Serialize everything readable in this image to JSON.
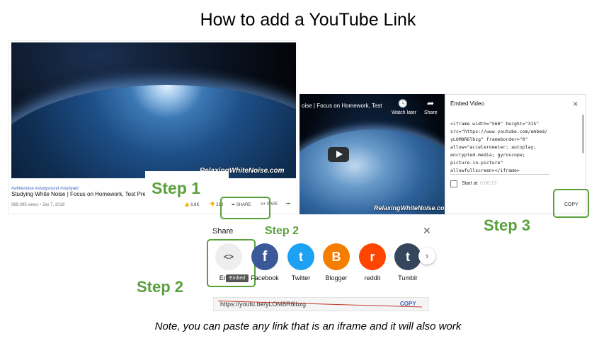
{
  "title": "How to add a YouTube Link",
  "step1": {
    "label": "Step 1"
  },
  "step2": {
    "label": "Step 2"
  },
  "step3": {
    "label": "Step 3"
  },
  "video1": {
    "watermark": "RelaxingWhiteNoise.com",
    "hashtags": "#whitenoise #studysound #studyaid",
    "title": "Studying White Noise | Focus on Homework, Test Prep,",
    "meta": "989,095 views • Jan 7, 2019",
    "likes": "6.8K",
    "dislikes": "213",
    "share": "SHARE",
    "save": "SAVE",
    "more": "•••"
  },
  "video2": {
    "caption": "oise | Focus on Homework, Test",
    "watch_later": "Watch later",
    "share": "Share",
    "watermark": "RelaxingWhiteNoise.com"
  },
  "embed": {
    "header": "Embed Video",
    "close": "✕",
    "code": [
      "<iframe width=\"560\" height=\"315\"",
      "src=\"https://www.youtube.com/embed/",
      "yLOM8R6lbzg\" frameborder=\"0\"",
      "allow=\"accelerometer; autoplay;",
      "encrypted-media; gyroscope;",
      "picture-in-picture\"",
      "allowfullscreen></iframe>"
    ],
    "start_at": "Start at",
    "start_time": "0:00:13",
    "copy": "COPY"
  },
  "share": {
    "heading": "Share",
    "close": "✕",
    "embed_glyph": "<>",
    "embed_label": "Embed",
    "tooltip": "Embed",
    "targets": [
      {
        "label": "Facebook",
        "glyph": "f",
        "color": "#3b5998"
      },
      {
        "label": "Twitter",
        "glyph": "t",
        "color": "#1da1f2"
      },
      {
        "label": "Blogger",
        "glyph": "B",
        "color": "#f57d00"
      },
      {
        "label": "reddit",
        "glyph": "r",
        "color": "#ff4500"
      },
      {
        "label": "Tumblr",
        "glyph": "t",
        "color": "#35465c"
      }
    ],
    "url": "https://youtu.be/yLOM8R6lbzg",
    "copy": "COPY"
  },
  "note": "Note, you can paste any link that is an iframe and it will also work"
}
